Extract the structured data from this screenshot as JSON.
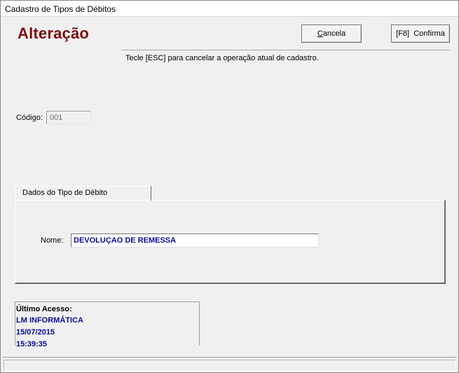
{
  "window": {
    "title": "Cadastro de Tipos de Débitos"
  },
  "header": {
    "mode": "Alteração",
    "cancel_label_pre": "",
    "cancel_label_acc": "C",
    "cancel_label_post": "ancela",
    "confirm_label": "[F8]  Confirma",
    "hint": "Tecle [ESC] para cancelar a operação atual de cadastro."
  },
  "form": {
    "codigo_label": "Código:",
    "codigo_value": "001",
    "tab_label": "Dados do Tipo de Débito",
    "nome_label": "Nome:",
    "nome_value": "DEVOLUÇAO DE REMESSA"
  },
  "access": {
    "title": "Último Acesso:",
    "user": "LM INFORMÁTICA",
    "date": "15/07/2015",
    "time": "15:39:35"
  },
  "colors": {
    "mode_text": "#7a0f0f",
    "value_text": "#0a0a9a"
  }
}
